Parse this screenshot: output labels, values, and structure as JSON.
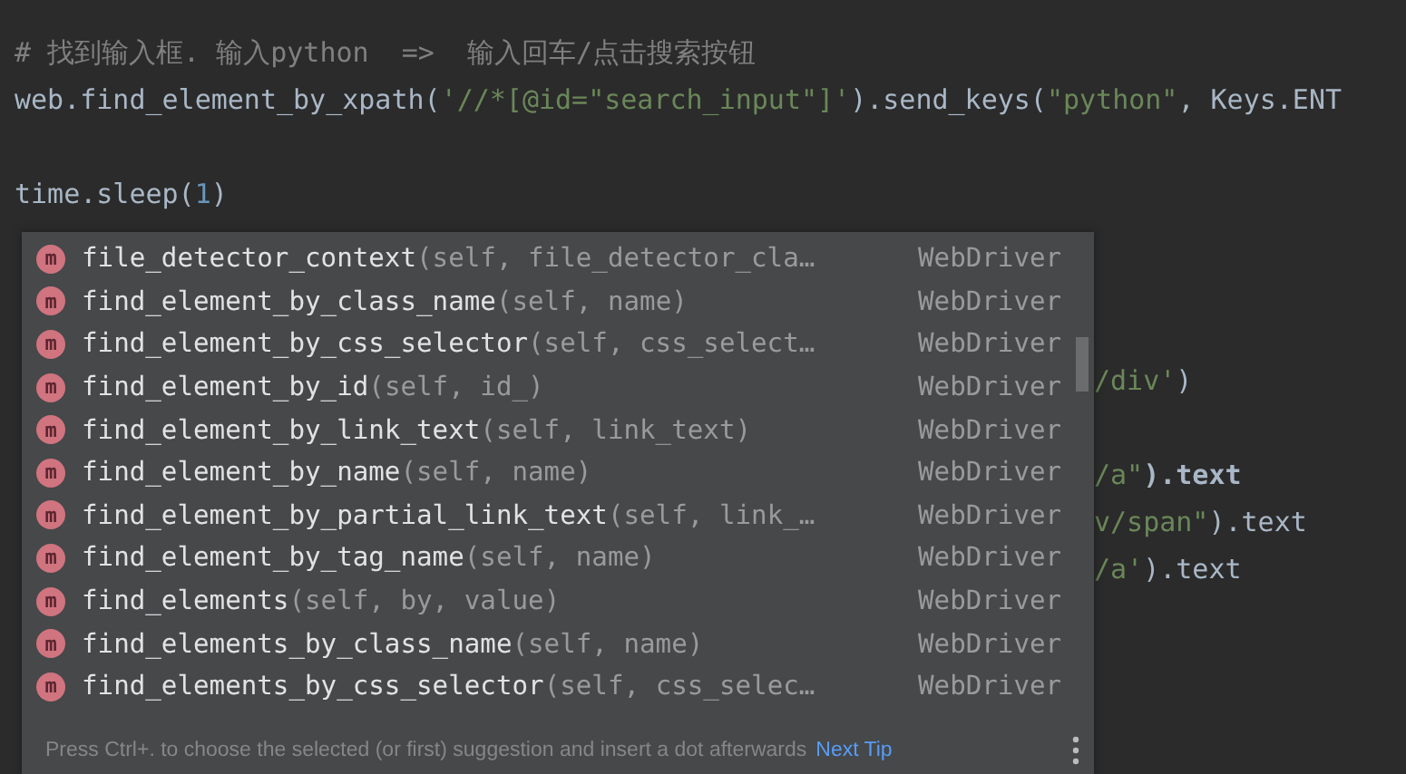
{
  "editor": {
    "blocks": [
      {
        "lines": [
          {
            "segments": [
              {
                "kind": "comment",
                "text": "# 找到输入框. 输入python  =>  输入回车/点击搜索按钮"
              }
            ]
          },
          {
            "segments": [
              {
                "kind": "code",
                "text": "web.find_element_by_xpath("
              },
              {
                "kind": "string",
                "text": "'//*[@id=\"search_input\"]'"
              },
              {
                "kind": "code",
                "text": ").send_keys("
              },
              {
                "kind": "string",
                "text": "\"python\""
              },
              {
                "kind": "code",
                "text": ", Keys.ENT"
              }
            ]
          }
        ]
      },
      {
        "lines": [
          {
            "segments": [
              {
                "kind": "code",
                "text": "time.sleep("
              },
              {
                "kind": "number",
                "text": "1"
              },
              {
                "kind": "code",
                "text": ")"
              }
            ]
          }
        ]
      }
    ],
    "hidden_blocks": [
      {
        "lines": [
          {
            "segments": [
              {
                "kind": "string",
                "text": "/div'"
              },
              {
                "kind": "code",
                "text": ")"
              }
            ]
          }
        ]
      },
      {
        "lines": [
          {
            "segments": [
              {
                "kind": "string",
                "text": "/a\""
              },
              {
                "kind": "bold",
                "text": ").text"
              }
            ]
          },
          {
            "segments": [
              {
                "kind": "string",
                "text": "v/span\""
              },
              {
                "kind": "code",
                "text": ").text"
              }
            ]
          },
          {
            "segments": [
              {
                "kind": "string",
                "text": "/a'"
              },
              {
                "kind": "code",
                "text": ").text"
              }
            ]
          }
        ]
      }
    ]
  },
  "completion": {
    "items": [
      {
        "icon": "m",
        "name": "file_detector_context",
        "params": "(self, file_detector_cla…",
        "type": "WebDriver"
      },
      {
        "icon": "m",
        "name": "find_element_by_class_name",
        "params": "(self, name)",
        "type": "WebDriver"
      },
      {
        "icon": "m",
        "name": "find_element_by_css_selector",
        "params": "(self, css_select…",
        "type": "WebDriver"
      },
      {
        "icon": "m",
        "name": "find_element_by_id",
        "params": "(self, id_)",
        "type": "WebDriver"
      },
      {
        "icon": "m",
        "name": "find_element_by_link_text",
        "params": "(self, link_text)",
        "type": "WebDriver"
      },
      {
        "icon": "m",
        "name": "find_element_by_name",
        "params": "(self, name)",
        "type": "WebDriver"
      },
      {
        "icon": "m",
        "name": "find_element_by_partial_link_text",
        "params": "(self, link_…",
        "type": "WebDriver"
      },
      {
        "icon": "m",
        "name": "find_element_by_tag_name",
        "params": "(self, name)",
        "type": "WebDriver"
      },
      {
        "icon": "m",
        "name": "find_elements",
        "params": "(self, by, value)",
        "type": "WebDriver"
      },
      {
        "icon": "m",
        "name": "find_elements_by_class_name",
        "params": "(self, name)",
        "type": "WebDriver"
      },
      {
        "icon": "m",
        "name": "find_elements_by_css_selector",
        "params": "(self, css_selec…",
        "type": "WebDriver"
      }
    ],
    "hint": "Press Ctrl+. to choose the selected (or first) suggestion and insert a dot afterwards",
    "hint_link": "Next Tip"
  }
}
